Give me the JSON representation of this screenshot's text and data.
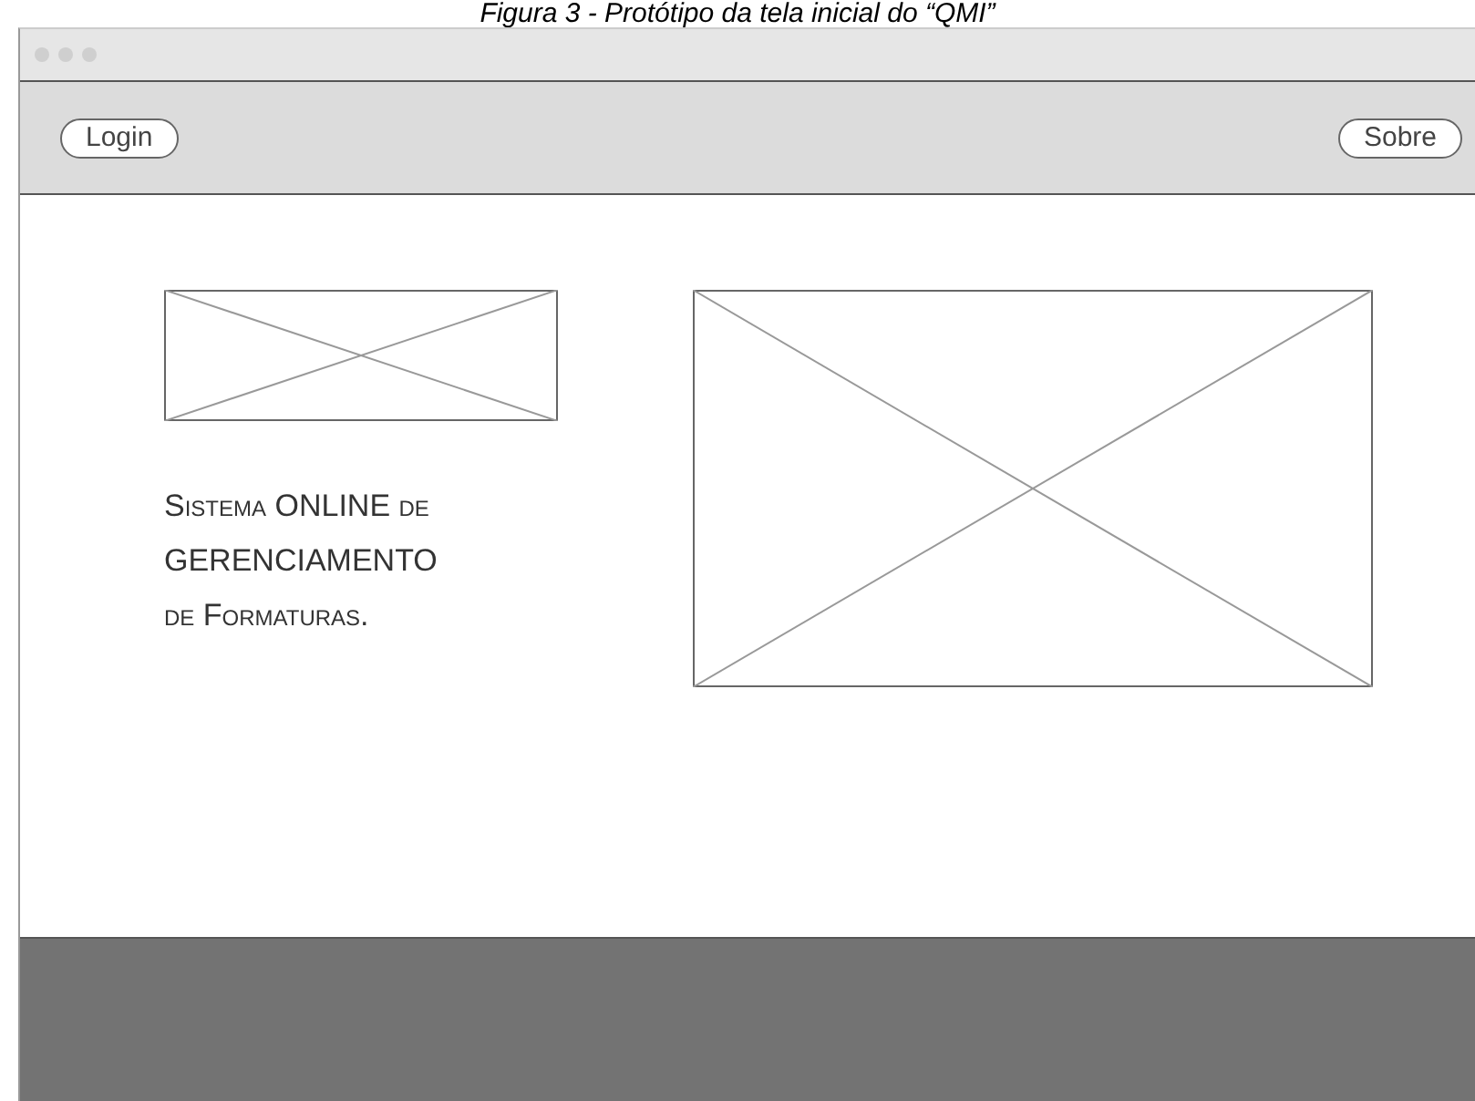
{
  "caption": "Figura 3 - Protótipo da tela inicial do “QMI”",
  "toolbar": {
    "left_button": "Login",
    "right_button": "Sobre"
  },
  "tagline": [
    "Sistema ONLINE de",
    "GERENCIAMENTO",
    "de Formaturas."
  ]
}
